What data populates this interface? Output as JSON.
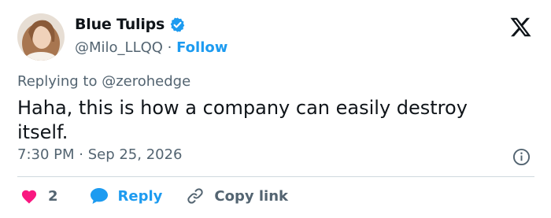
{
  "author": {
    "display_name": "Blue Tulips",
    "handle": "@Milo_LLQQ",
    "separator": " · ",
    "follow_label": "Follow"
  },
  "reply_context": {
    "prefix": "Replying to ",
    "mention": "@zerohedge"
  },
  "tweet": {
    "text": "Haha, this is how a company can easily destroy itself.",
    "timestamp": "7:30 PM · Sep 25, 2026"
  },
  "actions": {
    "like_count": "2",
    "reply_label": "Reply",
    "copy_link_label": "Copy link"
  },
  "colors": {
    "accent": "#1d9bf0",
    "like": "#f91880",
    "secondary_text": "#536471",
    "primary_text": "#0f1419"
  }
}
